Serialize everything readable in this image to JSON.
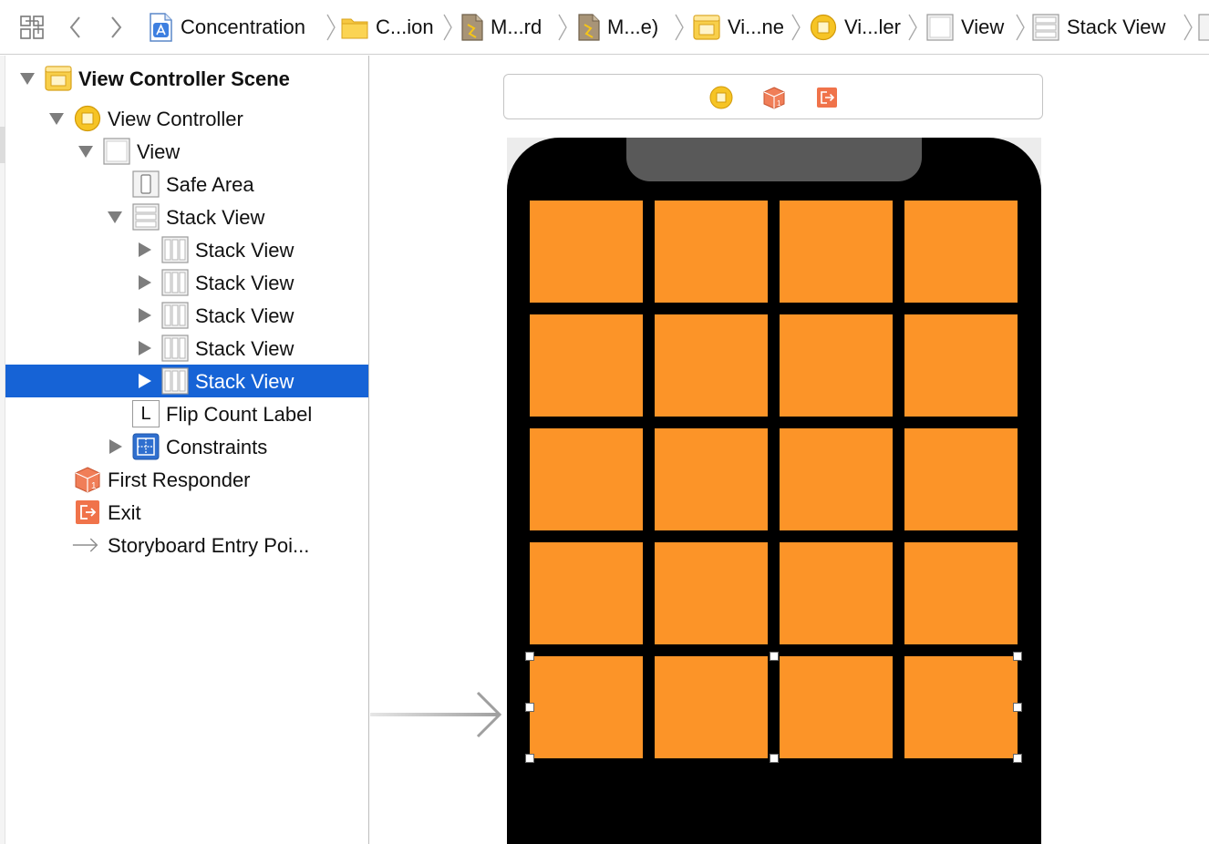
{
  "breadcrumb": {
    "items": [
      {
        "label": "Concentration",
        "icon": "app-project-icon"
      },
      {
        "label": "C...ion",
        "icon": "folder-icon"
      },
      {
        "label": "M...rd",
        "icon": "storyboard-file-icon"
      },
      {
        "label": "M...e)",
        "icon": "storyboard-file-icon"
      },
      {
        "label": "Vi...ne",
        "icon": "scene-icon"
      },
      {
        "label": "Vi...ler",
        "icon": "view-controller-icon"
      },
      {
        "label": "View",
        "icon": "view-icon"
      },
      {
        "label": "Stack View",
        "icon": "vertical-stack-icon"
      }
    ]
  },
  "outline": {
    "rows": [
      {
        "label": "View Controller Scene",
        "icon": "scene-icon",
        "disclosure": "expanded",
        "selected": false
      },
      {
        "label": "View Controller",
        "icon": "view-controller-icon",
        "disclosure": "expanded",
        "selected": false
      },
      {
        "label": "View",
        "icon": "view-icon",
        "disclosure": "expanded",
        "selected": false
      },
      {
        "label": "Safe Area",
        "icon": "safe-area-icon",
        "disclosure": "none",
        "selected": false
      },
      {
        "label": "Stack View",
        "icon": "vertical-stack-icon",
        "disclosure": "expanded",
        "selected": false
      },
      {
        "label": "Stack View",
        "icon": "horizontal-stack-icon",
        "disclosure": "collapsed",
        "selected": false
      },
      {
        "label": "Stack View",
        "icon": "horizontal-stack-icon",
        "disclosure": "collapsed",
        "selected": false
      },
      {
        "label": "Stack View",
        "icon": "horizontal-stack-icon",
        "disclosure": "collapsed",
        "selected": false
      },
      {
        "label": "Stack View",
        "icon": "horizontal-stack-icon",
        "disclosure": "collapsed",
        "selected": false
      },
      {
        "label": "Stack View",
        "icon": "horizontal-stack-icon",
        "disclosure": "collapsed",
        "selected": true
      },
      {
        "label": "Flip Count Label",
        "icon": "label-icon",
        "disclosure": "none",
        "selected": false
      },
      {
        "label": "Constraints",
        "icon": "constraints-icon",
        "disclosure": "collapsed",
        "selected": false
      },
      {
        "label": "First Responder",
        "icon": "first-responder-icon",
        "disclosure": "none",
        "selected": false
      },
      {
        "label": "Exit",
        "icon": "exit-icon",
        "disclosure": "none",
        "selected": false
      },
      {
        "label": "Storyboard Entry Poi...",
        "icon": "entry-point-arrow-icon",
        "disclosure": "none",
        "selected": false
      }
    ],
    "label_icon_glyph": "L"
  },
  "canvas": {
    "dock_icons": [
      "view-controller-icon",
      "first-responder-icon",
      "exit-icon"
    ],
    "grid": {
      "rows": 5,
      "columns": 4,
      "selected_row": 5
    },
    "colors": {
      "tile": "#fc9428",
      "device": "#000000",
      "notch": "#595959",
      "selection": "#1663d6",
      "exit": "#f0734a",
      "vc": "#f5c518"
    }
  }
}
